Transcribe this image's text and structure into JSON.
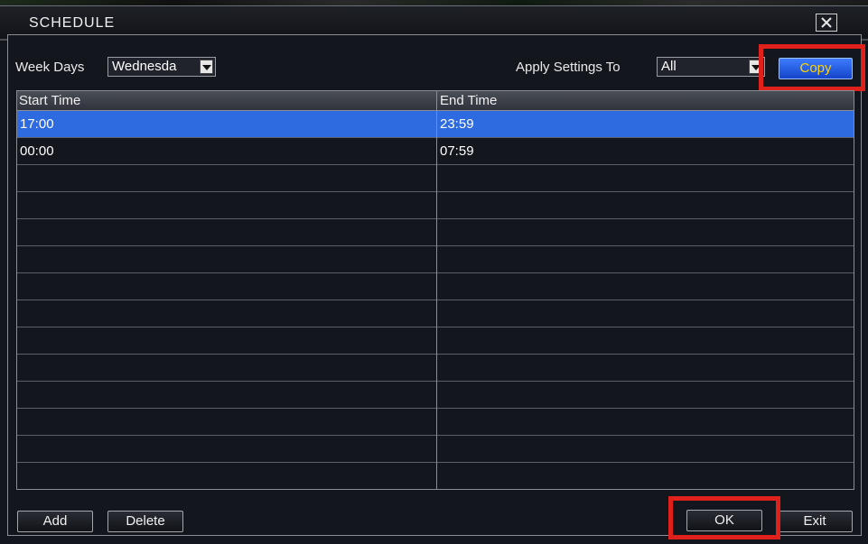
{
  "window": {
    "title": "SCHEDULE"
  },
  "controls": {
    "week_days_label": "Week Days",
    "week_days_value": "Wednesda",
    "apply_label": "Apply Settings To",
    "apply_value": "All",
    "copy_label": "Copy"
  },
  "table": {
    "columns": [
      "Start Time",
      "End Time"
    ],
    "rows": [
      {
        "start": "17:00",
        "end": "23:59",
        "selected": true
      },
      {
        "start": "00:00",
        "end": "07:59",
        "selected": false
      }
    ],
    "total_rows": 14
  },
  "footer": {
    "add_label": "Add",
    "delete_label": "Delete",
    "ok_label": "OK",
    "exit_label": "Exit"
  },
  "colors": {
    "selection": "#2f6be0",
    "copy_text": "#ffd400",
    "highlight_box": "#e0201a"
  }
}
